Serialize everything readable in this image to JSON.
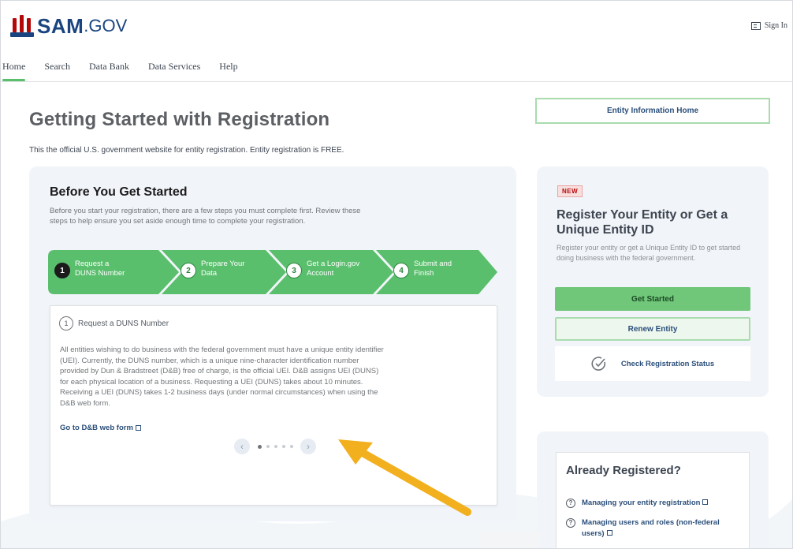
{
  "header": {
    "logo_sam": "SAM",
    "logo_gov": ".GOV",
    "sign_in": "Sign In",
    "logo_colors": {
      "red": "#b50909",
      "blue": "#1a4480"
    }
  },
  "nav": {
    "items": [
      "Home",
      "Search",
      "Data Bank",
      "Data Services",
      "Help"
    ],
    "active": "Home"
  },
  "main": {
    "title": "Getting Started with Registration",
    "subtitle": "This the official U.S. government website for entity registration. Entity registration is FREE.",
    "entity_info_button": "Entity Information Home"
  },
  "before": {
    "title": "Before You Get Started",
    "description": "Before you start your registration, there are a few steps you must complete first. Review these steps to help ensure you set aside enough time to complete your registration.",
    "steps": [
      {
        "num": "1",
        "label": "Request a DUNS Number",
        "current": true
      },
      {
        "num": "2",
        "label": "Prepare Your Data",
        "current": false
      },
      {
        "num": "3",
        "label": "Get a Login.gov Account",
        "current": false
      },
      {
        "num": "4",
        "label": "Submit and Finish",
        "current": false
      }
    ],
    "step_color": "#5abf6d",
    "detail": {
      "num": "1",
      "heading": "Request a DUNS Number",
      "body": "All entities wishing to do business with the federal government must have a unique entity identifier (UEI). Currently, the DUNS number, which is a unique nine-character identification number provided by Dun & Bradstreet (D&B) free of charge, is the official UEI. D&B assigns UEI (DUNS) for each physical location of a business. Requesting a UEI (DUNS) takes about 10 minutes. Receiving a UEI (DUNS) takes 1-2 business days (under normal circumstances) when using the D&B web form.",
      "link": "Go to D&B web form"
    },
    "carousel": {
      "prev": "‹",
      "next": "›",
      "dots": 5,
      "active_dot": 1
    }
  },
  "register": {
    "badge": "NEW",
    "title": "Register Your Entity or Get a Unique Entity ID",
    "description": "Register your entity or get a Unique Entity ID to get started doing business with the federal government.",
    "get_started": "Get Started",
    "renew": "Renew Entity",
    "check_status": "Check Registration Status"
  },
  "already": {
    "title": "Already Registered?",
    "links": [
      "Managing your entity registration",
      "Managing users and roles (non-federal users)"
    ]
  },
  "annotation_arrow_color": "#f2b01e"
}
